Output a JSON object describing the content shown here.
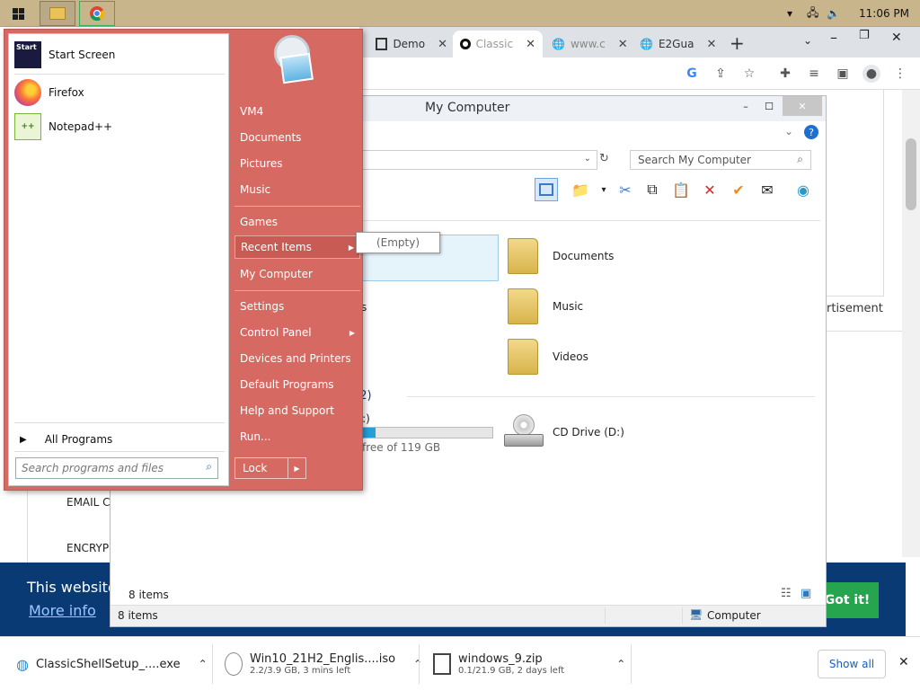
{
  "taskbar": {
    "time": "11:06 PM"
  },
  "chrome": {
    "tabs": [
      {
        "label": "Demo"
      },
      {
        "label": "Classic"
      },
      {
        "label": "www.c"
      },
      {
        "label": "E2Gua"
      }
    ],
    "new_tab": "+"
  },
  "page": {
    "advertisement_text": "rtisement",
    "email_text": "EMAIL C",
    "encrypt_text": "ENCRYP",
    "banner_text": "This website",
    "more_info": "More info",
    "got_it": "Got it!"
  },
  "explorer": {
    "title": "My Computer",
    "search_placeholder": "Search My Computer",
    "folders": [
      {
        "label": "Documents"
      },
      {
        "label": "Music"
      },
      {
        "label": "Videos"
      }
    ],
    "downloads_partial": "ads",
    "drives_header": "ives (2)",
    "local_disk_label": "sk (C:)",
    "local_disk_free": "free of 119 GB",
    "local_disk_fill_pct": 30,
    "cd_drive_label": "CD Drive (D:)",
    "status_items": "8 items",
    "status_items2": "8 items",
    "status_location": "Computer"
  },
  "start_menu": {
    "pinned": [
      {
        "label": "Start Screen"
      },
      {
        "label": "Firefox"
      },
      {
        "label": "Notepad++"
      }
    ],
    "all_programs": "All Programs",
    "search_placeholder": "Search programs and files",
    "right_items": [
      {
        "label": "VM4"
      },
      {
        "label": "Documents"
      },
      {
        "label": "Pictures"
      },
      {
        "label": "Music"
      },
      {
        "label": "Games"
      },
      {
        "label": "Recent Items"
      },
      {
        "label": "My Computer"
      },
      {
        "label": "Settings"
      },
      {
        "label": "Control Panel"
      },
      {
        "label": "Devices and Printers"
      },
      {
        "label": "Default Programs"
      },
      {
        "label": "Help and Support"
      },
      {
        "label": "Run..."
      }
    ],
    "lock_label": "Lock",
    "submenu_empty": "(Empty)",
    "start_tile_text": "Start"
  },
  "downloads": {
    "items": [
      {
        "name": "ClassicShellSetup_....exe",
        "status": ""
      },
      {
        "name": "Win10_21H2_Englis....iso",
        "status": "2.2/3.9 GB, 3 mins left"
      },
      {
        "name": "windows_9.zip",
        "status": "0.1/21.9 GB, 2 days left"
      }
    ],
    "show_all": "Show all"
  }
}
